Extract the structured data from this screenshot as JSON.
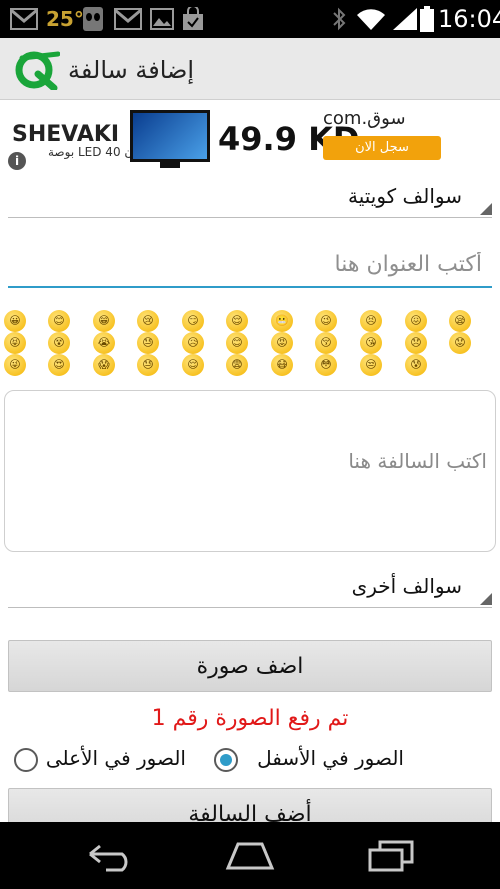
{
  "status_bar": {
    "temperature": "25°",
    "time": "16:04"
  },
  "app": {
    "title": "إضافة سالفة"
  },
  "ad": {
    "brand": "SHEVAKI",
    "subtitle": "تلفزيون LED 40 بوصة",
    "price": "49.9 KD",
    "store": "سوق.com",
    "cta": "سجل الان",
    "info_icon": "i"
  },
  "category_spinner": {
    "selected": "سوالف كويتية"
  },
  "title_input": {
    "placeholder": "أكتب العنوان هنا",
    "value": ""
  },
  "emojis": [
    "😀",
    "😊",
    "😁",
    "😢",
    "😏",
    "😌",
    "😬",
    "😉",
    "😣",
    "😖",
    "😪",
    "😝",
    "😵",
    "😭",
    "😓",
    "😥",
    "😊",
    "😡",
    "😚",
    "😘",
    "😞",
    "😟",
    "😜",
    "😍",
    "😱",
    "😓",
    "😌",
    "😨",
    "😷",
    "😳",
    "😒",
    "😰"
  ],
  "story_input": {
    "placeholder": "اكتب السالفة هنا",
    "value": ""
  },
  "section_spinner": {
    "selected": "سوالف أخرى"
  },
  "buttons": {
    "add_image": "اضف صورة",
    "add_story": "أضف السالفة"
  },
  "upload_status": "تم رفع الصورة رقم 1",
  "image_position": {
    "options": [
      "الصور في الأسفل",
      "الصور في الأعلى"
    ],
    "selected_index": 0
  },
  "colors": {
    "accent": "#2f9cc9",
    "status_error": "#e11919",
    "action_bar": "#e9e9e9"
  },
  "icons": {
    "logo": "app-logo-icon",
    "back": "back-icon",
    "home": "home-icon",
    "recents": "recents-icon"
  }
}
